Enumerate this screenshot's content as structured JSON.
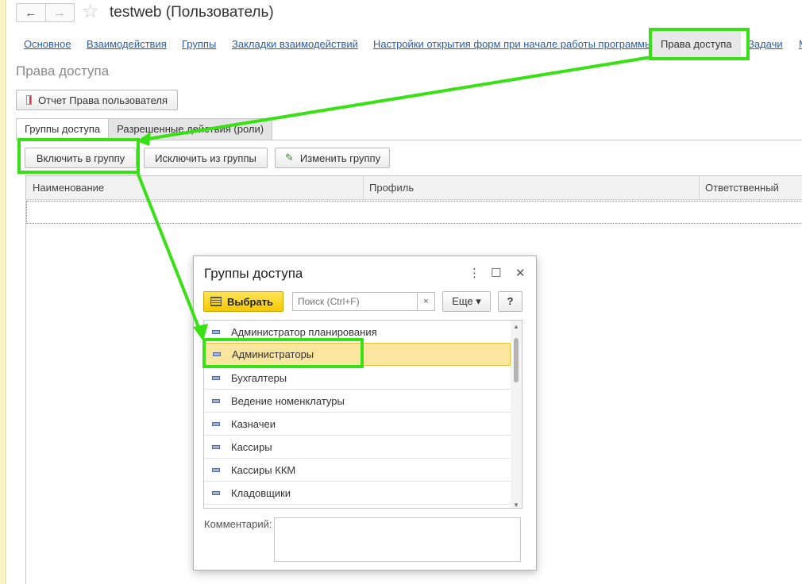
{
  "window": {
    "title": "testweb (Пользователь)",
    "back_icon": "←",
    "forward_icon": "→",
    "star_icon": "☆"
  },
  "nav": {
    "links": [
      "Основное",
      "Взаимодействия",
      "Группы",
      "Закладки взаимодействий",
      "Настройки открытия форм при начале работы программы"
    ],
    "active": "Права доступа",
    "after": [
      "Задачи",
      "М"
    ]
  },
  "section": {
    "title": "Права доступа",
    "report_button": "Отчет Права пользователя"
  },
  "tabs": [
    "Группы доступа",
    "Разрешенные действия (роли)"
  ],
  "toolbar": {
    "include": "Включить в группу",
    "exclude": "Исключить из группы",
    "edit": "Изменить группу"
  },
  "table": {
    "columns": [
      "Наименование",
      "Профиль",
      "Ответственный"
    ]
  },
  "dialog": {
    "title": "Группы доступа",
    "menu_icon": "⋮",
    "maximize_icon": "☐",
    "close_icon": "✕",
    "select_label": "Выбрать",
    "search_placeholder": "Поиск (Ctrl+F)",
    "clear_icon": "×",
    "more_label": "Еще ▾",
    "help_label": "?",
    "items": [
      "Администратор планирования",
      "Администраторы",
      "Бухгалтеры",
      "Ведение номенклатуры",
      "Казначеи",
      "Кассиры",
      "Кассиры ККМ",
      "Кладовщики"
    ],
    "selected_index": 1,
    "comment_label": "Комментарий:"
  },
  "colors": {
    "highlight": "#39e015",
    "link": "#2a5eab",
    "selected_row": "#fbe6a0",
    "select_button": "#f5c800"
  }
}
